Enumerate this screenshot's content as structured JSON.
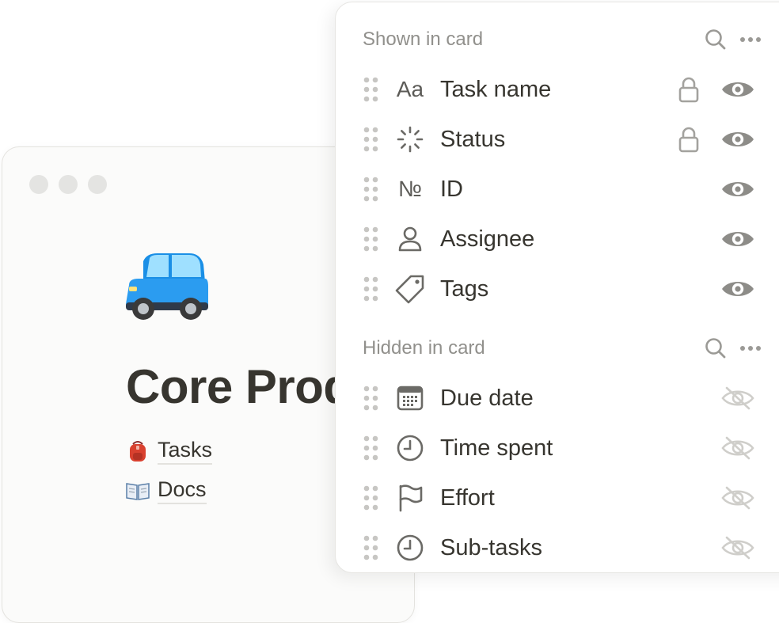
{
  "page": {
    "title": "Core Product",
    "icon": "car-emoji",
    "links": [
      {
        "emoji": "backpack-emoji",
        "label": "Tasks"
      },
      {
        "emoji": "open-book-emoji",
        "label": "Docs"
      }
    ]
  },
  "panel": {
    "shown": {
      "title": "Shown in card",
      "properties": [
        {
          "icon": "text-aa-icon",
          "icon_text": "Aa",
          "name": "Task name",
          "locked": true,
          "visible": true
        },
        {
          "icon": "status-loader-icon",
          "name": "Status",
          "locked": true,
          "visible": true
        },
        {
          "icon": "number-icon",
          "icon_text": "№",
          "name": "ID",
          "locked": false,
          "visible": true
        },
        {
          "icon": "person-icon",
          "name": "Assignee",
          "locked": false,
          "visible": true
        },
        {
          "icon": "tag-icon",
          "name": "Tags",
          "locked": false,
          "visible": true
        }
      ]
    },
    "hidden": {
      "title": "Hidden in card",
      "properties": [
        {
          "icon": "calendar-icon",
          "name": "Due date",
          "visible": false
        },
        {
          "icon": "clock-icon",
          "name": "Time spent",
          "visible": false
        },
        {
          "icon": "flag-icon",
          "name": "Effort",
          "visible": false
        },
        {
          "icon": "clock-icon",
          "name": "Sub-tasks",
          "visible": false
        }
      ]
    }
  },
  "colors": {
    "accent_icon": "#91908c",
    "text": "#37352f",
    "muted": "#91908c"
  }
}
